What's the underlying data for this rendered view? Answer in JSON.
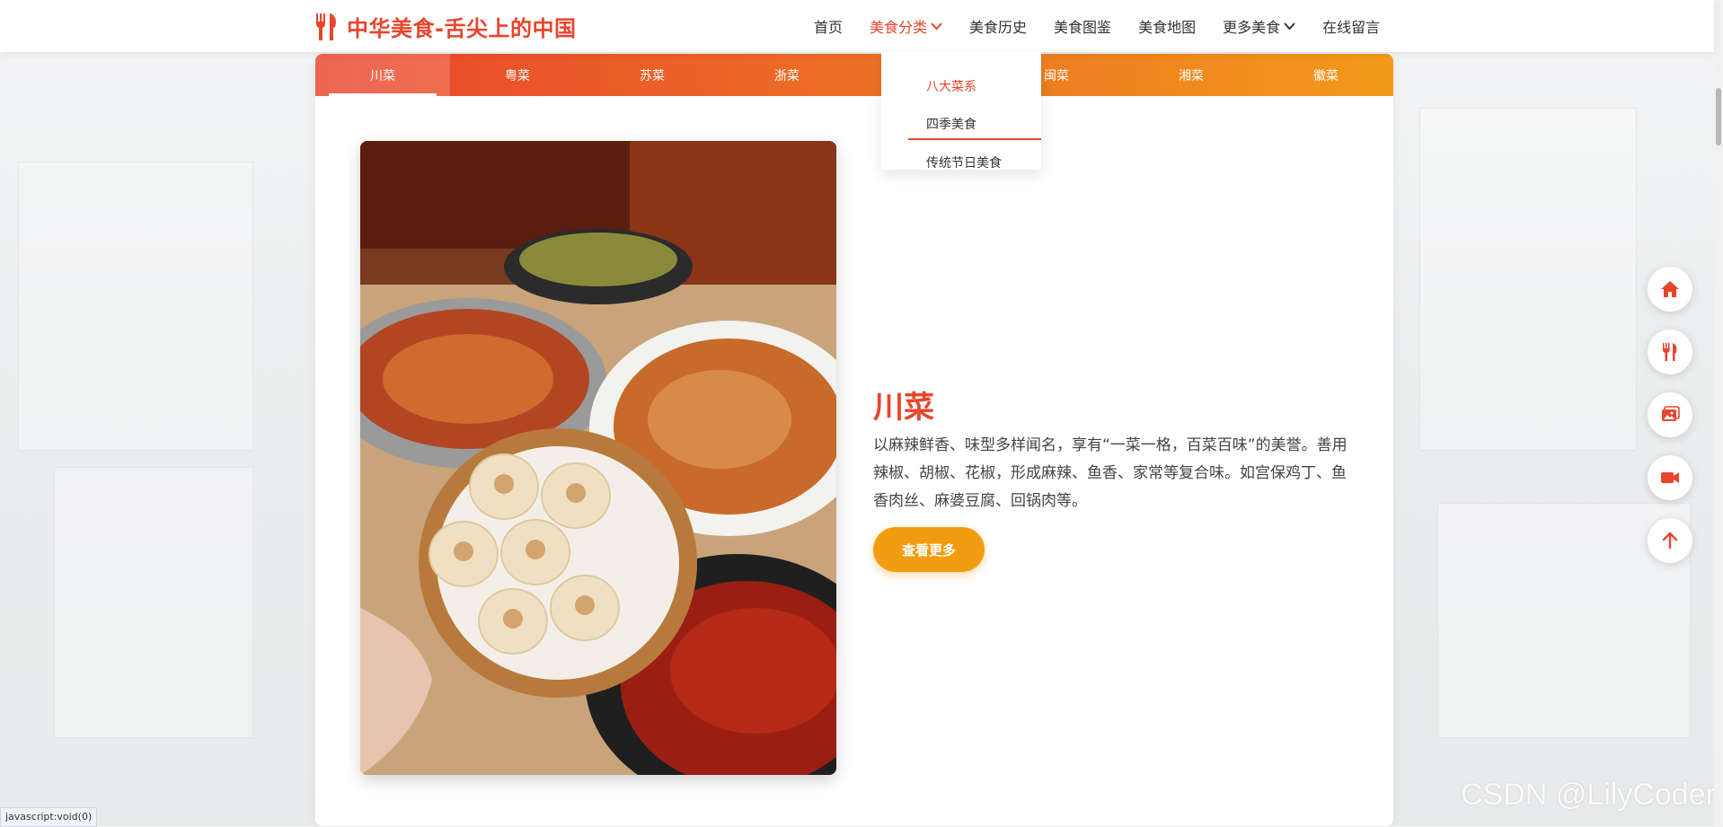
{
  "header": {
    "site_title": "中华美食-舌尖上的中国",
    "nav": [
      {
        "label": "首页"
      },
      {
        "label": "美食分类"
      },
      {
        "label": "美食历史"
      },
      {
        "label": "美食图鉴"
      },
      {
        "label": "美食地图"
      },
      {
        "label": "更多美食"
      },
      {
        "label": "在线留言"
      }
    ]
  },
  "dropdown": {
    "items": [
      {
        "label": "八大菜系"
      },
      {
        "label": "四季美食"
      },
      {
        "label": "传统节日美食"
      }
    ]
  },
  "tabs": [
    {
      "label": "川菜"
    },
    {
      "label": "粤菜"
    },
    {
      "label": "苏菜"
    },
    {
      "label": "浙菜"
    },
    {
      "label": "闽菜"
    },
    {
      "label": "闽菜"
    },
    {
      "label": "湘菜"
    },
    {
      "label": "徽菜"
    }
  ],
  "dish": {
    "title": "川菜",
    "description": "以麻辣鲜香、味型多样闻名，享有“一菜一格，百菜百味”的美誉。善用辣椒、胡椒、花椒，形成麻辣、鱼香、家常等复合味。如宫保鸡丁、鱼香肉丝、麻婆豆腐、回锅肉等。",
    "button_label": "查看更多"
  },
  "float_buttons": [
    {
      "icon": "home-icon"
    },
    {
      "icon": "utensils-icon"
    },
    {
      "icon": "image-icon"
    },
    {
      "icon": "video-icon"
    },
    {
      "icon": "arrow-up-icon"
    }
  ],
  "status_bar": "javascript:void(0)",
  "watermark": "CSDN @LilyCoder",
  "colors": {
    "accent": "#e8452c",
    "orange": "#f39c12"
  }
}
